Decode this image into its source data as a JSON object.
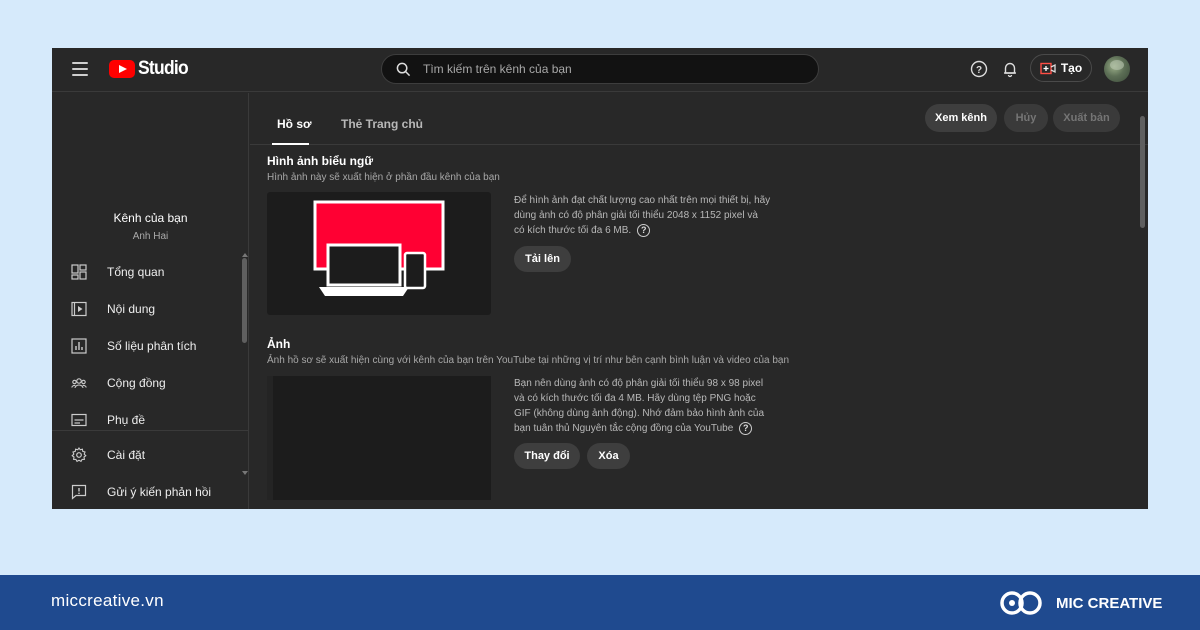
{
  "app": {
    "logo_text": "Studio",
    "search_placeholder": "Tìm kiếm trên kênh của bạn",
    "create_label": "Tạo"
  },
  "sidebar": {
    "channel_title": "Kênh của bạn",
    "channel_name": "Anh Hai",
    "items": [
      {
        "label": "Tổng quan",
        "icon": "dashboard-icon"
      },
      {
        "label": "Nội dung",
        "icon": "content-icon"
      },
      {
        "label": "Số liệu phân tích",
        "icon": "analytics-icon"
      },
      {
        "label": "Cộng đồng",
        "icon": "community-icon"
      },
      {
        "label": "Phụ đề",
        "icon": "subtitles-icon"
      }
    ],
    "bottom_items": [
      {
        "label": "Cài đặt",
        "icon": "gear-icon"
      },
      {
        "label": "Gửi ý kiến phản hồi",
        "icon": "feedback-icon"
      }
    ]
  },
  "tabs": [
    {
      "label": "Hồ sơ",
      "active": true
    },
    {
      "label": "Thẻ Trang chủ",
      "active": false
    }
  ],
  "actions": {
    "view_channel": "Xem kênh",
    "cancel": "Hủy",
    "publish": "Xuất bản"
  },
  "banner": {
    "title": "Hình ảnh biểu ngữ",
    "description": "Hình ảnh này sẽ xuất hiện ở phần đầu kênh của bạn",
    "info_line1": "Để hình ảnh đạt chất lượng cao nhất trên mọi thiết bị, hãy",
    "info_line2": "dùng ảnh có độ phân giải tối thiểu 2048 x 1152 pixel và",
    "info_line3": "có kích thước tối đa 6 MB.",
    "upload_label": "Tải lên"
  },
  "photo": {
    "title": "Ảnh",
    "description": "Ảnh hồ sơ sẽ xuất hiện cùng với kênh của bạn trên YouTube tại những vị trí như bên cạnh bình luận và video của bạn",
    "info_line1": "Bạn nên dùng ảnh có độ phân giải tối thiểu 98 x 98 pixel",
    "info_line2": "và có kích thước tối đa 4 MB. Hãy dùng tệp PNG hoặc",
    "info_line3": "GIF (không dùng ảnh động). Nhớ đảm bảo hình ảnh của",
    "info_line4": "bạn tuân thủ Nguyên tắc cộng đồng của YouTube",
    "change_label": "Thay đổi",
    "delete_label": "Xóa"
  },
  "footer": {
    "url": "miccreative.vn",
    "brand": "MIC CREATIVE"
  },
  "colors": {
    "background": "#d6eafb",
    "window": "#282828",
    "footer": "#1f4a8f",
    "accent_red": "#ff0033"
  }
}
